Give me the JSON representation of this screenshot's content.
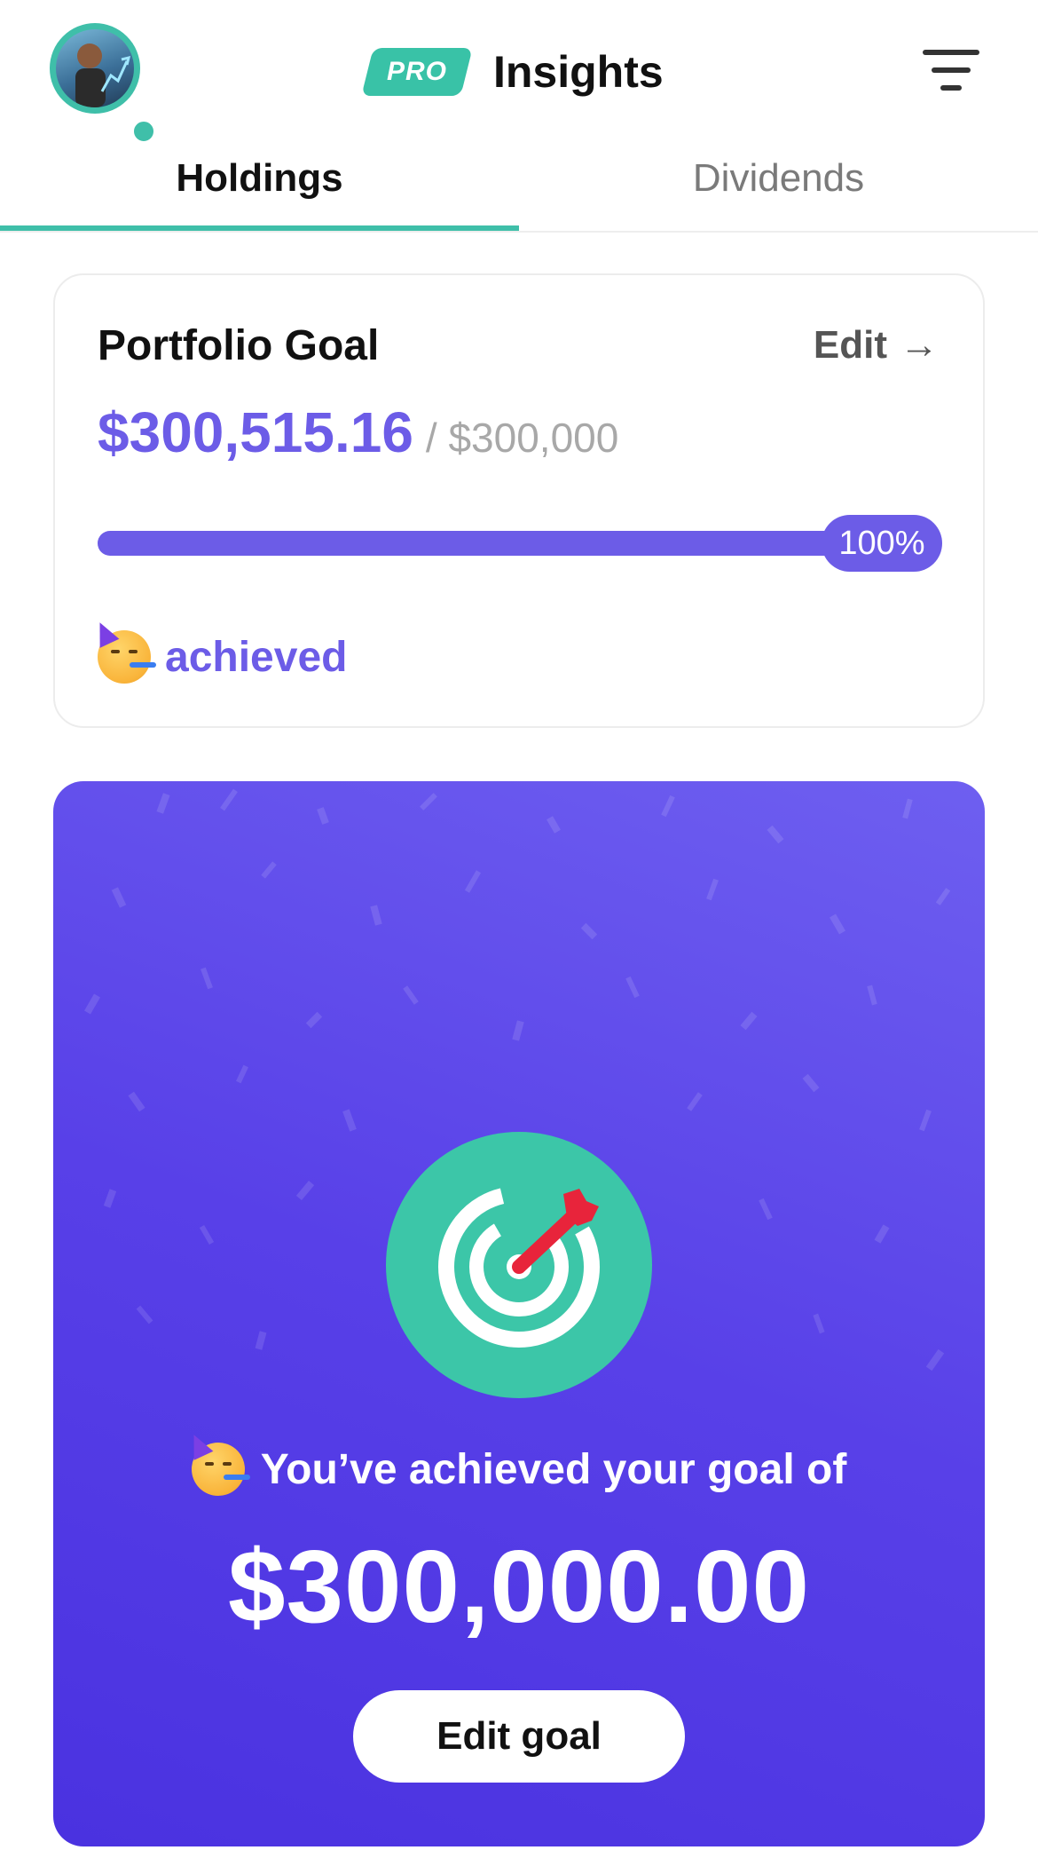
{
  "header": {
    "pro_badge": "PRO",
    "title": "Insights",
    "icons": {
      "avatar": "avatar-icon",
      "filter": "filter-icon"
    }
  },
  "tabs": [
    {
      "label": "Holdings",
      "active": true
    },
    {
      "label": "Dividends",
      "active": false
    }
  ],
  "portfolio_goal": {
    "title": "Portfolio Goal",
    "edit_label": "Edit",
    "edit_arrow": "→",
    "current_value": "$300,515.16",
    "target_value": "/ $300,000",
    "progress_percent_label": "100%",
    "progress_fraction": 1.0,
    "status_text": "achieved",
    "status_emoji": "partying-face-icon"
  },
  "celebration": {
    "message": "You’ve achieved your goal of",
    "goal_amount": "$300,000.00",
    "edit_button": "Edit goal",
    "icon": "target-dart-icon"
  },
  "colors": {
    "accent_purple": "#6c5ce7",
    "accent_teal": "#3fbfa9",
    "card_purple": "#5840e8",
    "dart_red": "#e8243b"
  }
}
